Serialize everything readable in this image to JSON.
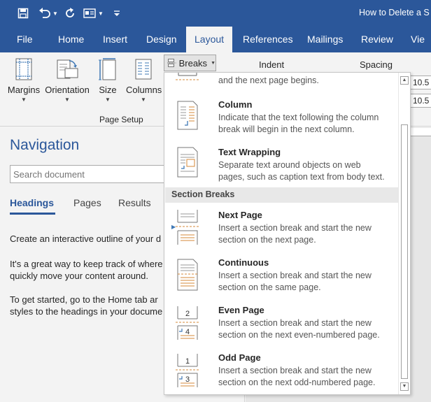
{
  "titlebar": {
    "doc_title": "How to Delete a S",
    "icons": [
      "save-icon",
      "undo-icon",
      "redo-icon",
      "touch-mode-icon",
      "customize-qat-icon"
    ]
  },
  "tabs": [
    "File",
    "Home",
    "Insert",
    "Design",
    "Layout",
    "References",
    "Mailings",
    "Review",
    "View"
  ],
  "tabs_visible": [
    "File",
    "Home",
    "Insert",
    "Design",
    "Layout",
    "References",
    "Mailings",
    "Review",
    "Vie"
  ],
  "active_tab": "Layout",
  "ribbon": {
    "margins": "Margins",
    "orientation": "Orientation",
    "size": "Size",
    "columns": "Columns",
    "group_label": "Page Setup",
    "breaks": "Breaks",
    "indent": "Indent",
    "spacing": "Spacing",
    "spin1": "10.5",
    "spin2": "10.5"
  },
  "nav": {
    "title": "Navigation",
    "search_placeholder": "Search document",
    "tabs": [
      "Headings",
      "Pages",
      "Results"
    ],
    "p1": "Create an interactive outline of your d",
    "p2a": "It's a great way to keep track of where",
    "p2b": "quickly move your content around.",
    "p3a": "To get started, go to the Home tab ar",
    "p3b": "styles to the headings in your docume"
  },
  "breaks_menu": {
    "partial_desc": "and the next page begins.",
    "items": [
      {
        "title": "Column",
        "desc1": "Indicate that the text following the column",
        "desc2": "break will begin in the next column."
      },
      {
        "title": "Text Wrapping",
        "desc1": "Separate text around objects on web",
        "desc2": "pages, such as caption text from body text."
      }
    ],
    "section_header": "Section Breaks",
    "section_items": [
      {
        "title": "Next Page",
        "desc1": "Insert a section break and start the new",
        "desc2": "section on the next page."
      },
      {
        "title": "Continuous",
        "desc1": "Insert a section break and start the new",
        "desc2": "section on the same page."
      },
      {
        "title": "Even Page",
        "desc1": "Insert a section break and start the new",
        "desc2": "section on the next even-numbered page."
      },
      {
        "title": "Odd Page",
        "desc1": "Insert a section break and start the new",
        "desc2": "section on the next odd-numbered page."
      }
    ],
    "even_numbers": [
      "2",
      "4"
    ],
    "odd_numbers": [
      "1",
      "3"
    ]
  },
  "colors": {
    "accent": "#2b579a",
    "icon_orange": "#d68a3a",
    "icon_blue": "#3f78b5"
  }
}
